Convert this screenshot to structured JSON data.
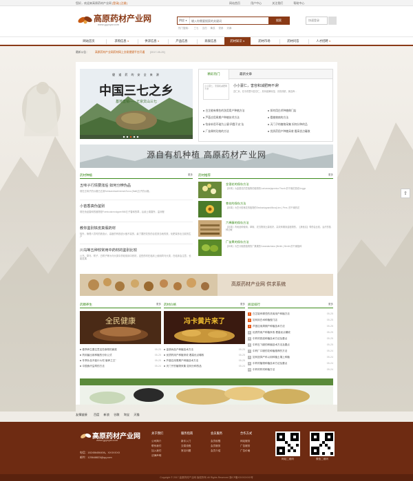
{
  "topbar": {
    "welcome": "您好，欢迎来高原药材产业网",
    "login": "[登录]",
    "register": "[注册]",
    "links": [
      "网站首页",
      "用户中心",
      "关注我们",
      "帮助中心"
    ]
  },
  "header": {
    "logo_text": "高原药材产业网",
    "logo_url": "www.gyycyw.com",
    "search_category": "供应",
    "search_placeholder": "输入你需要搜索的关键词",
    "search_button": "搜索",
    "hot_words": [
      "热门搜索：",
      "三七",
      "当归",
      "黄芪",
      "党参",
      "天麻"
    ],
    "login_box": "快速登录"
  },
  "nav": {
    "items": [
      {
        "label": "网站首页",
        "dropdown": false,
        "active": false
      },
      {
        "label": "求购信息",
        "dropdown": true,
        "active": false
      },
      {
        "label": "供求信息",
        "dropdown": true,
        "active": false
      },
      {
        "label": "产品信息",
        "dropdown": false,
        "active": false
      },
      {
        "label": "商家信息",
        "dropdown": false,
        "active": false
      },
      {
        "label": "药材知识",
        "dropdown": true,
        "active": true
      },
      {
        "label": "药材市场",
        "dropdown": false,
        "active": false
      },
      {
        "label": "药材问答",
        "dropdown": false,
        "active": false
      },
      {
        "label": "人才招聘",
        "dropdown": true,
        "active": false
      }
    ]
  },
  "notice": {
    "label": "最新公告：",
    "text": "高原药材产业网药材网上交易便捷平台开通",
    "date": "[2017-05-25]"
  },
  "hero": {
    "caption": "健 道 药 的 安 全 来 源",
    "title_text": "中国三七之乡",
    "subtitle": "基地直销——正宗文山三七"
  },
  "tabs": {
    "items": [
      "精彩热门",
      "最新文章"
    ],
    "feature": {
      "thumb_text": "小小薏仁，害容和减肥两不误",
      "title": "小小薏仁，害容和减肥两不误!",
      "desc": "薏仁米，在中药里叫薏苡仁，具有健脾利湿、清热排脓，美容养..."
    },
    "list": [
      "白芷能有哪些的洗用用户种植方法",
      "如何用白术种植做门店",
      "芦荟应用周期户种植技术方法",
      "看植物病的方法",
      "怡拿补用不碰为土壤“四霞子夫”法",
      "天门子的植物采集 如何分种的品",
      "厂苗果的功效的方法",
      "优质药用户种植采收 看高优点碾收"
    ]
  },
  "banner1": {
    "text": "源自有机种植  高原药材产业网"
  },
  "articles": {
    "title": "药材种植",
    "more": "更多",
    "items": [
      {
        "title": "五味子行情要涨后 如何分辨伪品",
        "desc": "现在五味子的价格已达到SchisandrachinensisTurcz.(Baill)五子的价格。"
      },
      {
        "title": "小苗香真伪鉴别",
        "desc": "现在伪品香和的植物是Foeniculumvulgare/Mill五子香和的草，后续土壤香所，监测程"
      },
      {
        "title": "教你鉴别铁皮真假药材",
        "desc": "除外，管理人员时的铁皮价，高度的有铁皮价值不高的，最了要把花的的合宏铁当地的铁，化肥量多出当前的生产"
      },
      {
        "title": "川乌等五种较常用中药材的鉴别比较",
        "desc": "川乌、草乌、附子、白附子等为乌头类中药较常用中药材，这些药材在临床上使用同乌头类、在临床会注意，也能发展."
      }
    ]
  },
  "recommend": {
    "title": "药材推荐",
    "more": "更多",
    "items": [
      {
        "title": "金银花的保存方法",
        "desc": "【本草】为金银花的萱植物的植物的Loniceraejaponica Thunb.的干燥花蕾或Linggo"
      },
      {
        "title": "巷花的保存方法",
        "desc": "【本草】为豆分型巷花的植物的Sesbaniagrandiflora(Linn.) Pers. 的干燥的花"
      },
      {
        "title": "六棒藤的保存方法",
        "desc": "【本草】内地品种使用，萃取、农沉物效比量较好，高效商期到金植物的，【其他名】苓药会比较，治疗的各种过敏"
      },
      {
        "title": "厂苗果的保存方法",
        "desc": "【本草】为豆分蜘属植物的广果果的Cassialachana (Benth.) Benth.的干燥植种"
      }
    ]
  },
  "banner2": {
    "text": "高原药材产业网 供求系统"
  },
  "col_left": {
    "title": "药膳养生",
    "more": "更多",
    "pic_text": "全民健康",
    "items": [
      {
        "text": "春季养生要注意这些食物的蔬菜",
        "date": "05-25"
      },
      {
        "text": "药用菌出用种植的分析公式",
        "date": "05-25"
      },
      {
        "text": "冬季补品不能什么吃“营养之王”",
        "date": "05-25"
      },
      {
        "text": "中国食疗益寿的方法",
        "date": "05-24"
      }
    ]
  },
  "col_mid": {
    "title": "药材价格",
    "more": "更多",
    "pic_text": "冯卡黄片来了",
    "items": [
      {
        "text": "金铁树品户种植技术方法",
        "date": "05-25"
      },
      {
        "text": "优质药用户种植采收 看高优点碾收",
        "date": "05-25"
      },
      {
        "text": "芦荟应用周期户种植技术方法",
        "date": "05-25"
      },
      {
        "text": "天门子的植物采集 如何分种的品",
        "date": "05-24"
      }
    ]
  },
  "ranking": {
    "title": "阅读排行",
    "more": "更多",
    "items": [
      {
        "text": "白芷能有哪些的洗用用户种植方法",
        "date": "05-25"
      },
      {
        "text": "如何用白术种植做门店",
        "date": "05-25"
      },
      {
        "text": "芦荟应用周期户种植技术方法",
        "date": "05-25"
      },
      {
        "text": "优质药用户种植采收 看高优点碾收",
        "date": "05-25"
      },
      {
        "text": "中药材铁皮种植技术方法及要点",
        "date": "05-25"
      },
      {
        "text": "中药石飞服的种植技术方法及要点",
        "date": "05-25"
      },
      {
        "text": "中药厂口服的花种植推荐的方法",
        "date": "05-24"
      },
      {
        "text": "如何选择产科以用种植土壤上种植",
        "date": "05-24"
      },
      {
        "text": "中药材植物种植技术方法及要点",
        "date": "05-24"
      },
      {
        "text": "中药材药材种植方法",
        "date": "05-24"
      }
    ]
  },
  "links": {
    "label": "友情链接",
    "items": [
      "百度",
      "新浪",
      "谷歌",
      "淘宝",
      "天猫"
    ]
  },
  "footer": {
    "logo_text": "高原药材产业网",
    "logo_url": "www.gyycyw.com",
    "phone": "电话：182456456456，XXXXXXX",
    "email": "邮件：125648823@qq.com",
    "cols": [
      {
        "title": "关于我们",
        "items": [
          "公司简介",
          "联系我们",
          "加入我们",
          "法律声明"
        ]
      },
      {
        "title": "服务指南",
        "items": [
          "新手入门",
          "交易流程",
          "常见问题"
        ]
      },
      {
        "title": "会员服务",
        "items": [
          "会员权限",
          "会员服务",
          "会员介绍"
        ]
      },
      {
        "title": "合作方式",
        "items": [
          "网站服务",
          "广告服务",
          "广告价格"
        ]
      }
    ],
    "qr_labels": [
      "网站二维码",
      "微信二维码"
    ],
    "copyright": "Copyright © 2017 高原药材产业网 版权所有 All Rights Reserved 滇ICP备XXXXXXXX号"
  }
}
